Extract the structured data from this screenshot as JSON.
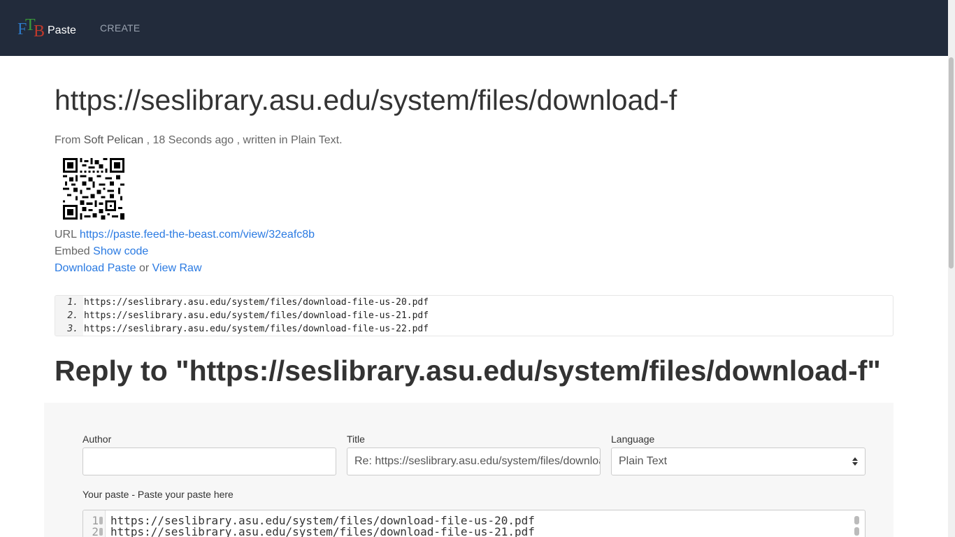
{
  "navbar": {
    "logo_letters": [
      "F",
      "T",
      "B"
    ],
    "brand_word": "Paste",
    "create_label": "CREATE"
  },
  "paste": {
    "title": "https://seslibrary.asu.edu/system/files/download-f",
    "meta": {
      "from_prefix": "From",
      "author": "Soft Pelican",
      "time_sep": ",",
      "time": "18 Seconds ago",
      "lang_prefix": ", written in",
      "language": "Plain Text."
    },
    "url_label": "URL",
    "url_value": "https://paste.feed-the-beast.com/view/32eafc8b",
    "embed_label": "Embed",
    "embed_link": "Show code",
    "download_link": "Download Paste",
    "or_text": "or",
    "raw_link": "View Raw",
    "lines": [
      {
        "num": "1.",
        "text": "https://seslibrary.asu.edu/system/files/download-file-us-20.pdf"
      },
      {
        "num": "2.",
        "text": "https://seslibrary.asu.edu/system/files/download-file-us-21.pdf"
      },
      {
        "num": "3.",
        "text": "https://seslibrary.asu.edu/system/files/download-file-us-22.pdf"
      }
    ]
  },
  "reply": {
    "heading": "Reply to \"https://seslibrary.asu.edu/system/files/download-f\"",
    "author_label": "Author",
    "author_value": "",
    "title_label": "Title",
    "title_value": "Re: https://seslibrary.asu.edu/system/files/download-f",
    "language_label": "Language",
    "language_value": "Plain Text",
    "paste_label": "Your paste - Paste your paste here",
    "editor_lines": [
      {
        "num": "1",
        "text": "https://seslibrary.asu.edu/system/files/download-file-us-20.pdf"
      },
      {
        "num": "2",
        "text": "https://seslibrary.asu.edu/system/files/download-file-us-21.pdf"
      }
    ]
  },
  "colors": {
    "navbar_bg": "#222b3b",
    "link": "#2a7ae2",
    "panel_bg": "#f7f7f7"
  }
}
